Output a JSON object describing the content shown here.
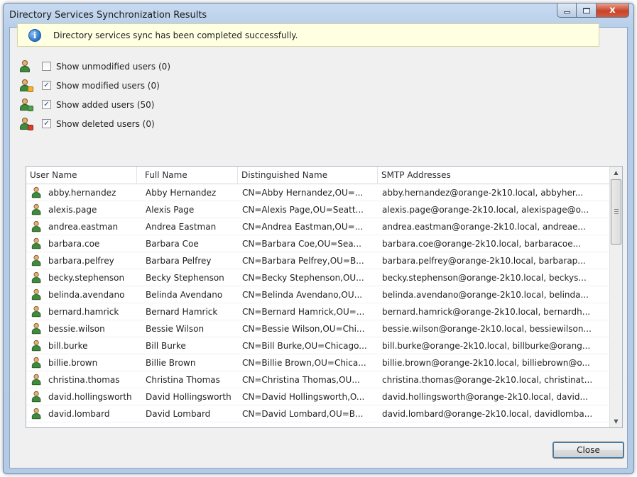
{
  "window": {
    "title": "Directory Services Synchronization Results",
    "close_glyph": "x"
  },
  "banner": {
    "icon": "info-icon",
    "icon_glyph": "i",
    "message": "Directory services sync has been completed successfully."
  },
  "filters": [
    {
      "label": "Show unmodified users (0)",
      "checked": false,
      "icon": "user-icon",
      "mark": ""
    },
    {
      "label": "Show modified users (0)",
      "checked": true,
      "icon": "user-edit-icon",
      "mark": "✓"
    },
    {
      "label": "Show added users (50)",
      "checked": true,
      "icon": "user-add-icon",
      "mark": "✓"
    },
    {
      "label": "Show deleted users (0)",
      "checked": true,
      "icon": "user-delete-icon",
      "mark": "✓"
    }
  ],
  "grid": {
    "columns": [
      "User Name",
      "Full Name",
      "Distinguished Name",
      "SMTP Addresses"
    ],
    "rows": [
      [
        "abby.hernandez",
        "Abby Hernandez",
        "CN=Abby Hernandez,OU=...",
        "abby.hernandez@orange-2k10.local, abbyher..."
      ],
      [
        "alexis.page",
        "Alexis Page",
        "CN=Alexis Page,OU=Seatt...",
        "alexis.page@orange-2k10.local, alexispage@o..."
      ],
      [
        "andrea.eastman",
        "Andrea Eastman",
        "CN=Andrea Eastman,OU=...",
        "andrea.eastman@orange-2k10.local, andreae..."
      ],
      [
        "barbara.coe",
        "Barbara Coe",
        "CN=Barbara Coe,OU=Sea...",
        "barbara.coe@orange-2k10.local, barbaracoe..."
      ],
      [
        "barbara.pelfrey",
        "Barbara Pelfrey",
        "CN=Barbara Pelfrey,OU=B...",
        "barbara.pelfrey@orange-2k10.local, barbarap..."
      ],
      [
        "becky.stephenson",
        "Becky Stephenson",
        "CN=Becky Stephenson,OU...",
        "becky.stephenson@orange-2k10.local, beckys..."
      ],
      [
        "belinda.avendano",
        "Belinda Avendano",
        "CN=Belinda Avendano,OU...",
        "belinda.avendano@orange-2k10.local, belinda..."
      ],
      [
        "bernard.hamrick",
        "Bernard Hamrick",
        "CN=Bernard Hamrick,OU=...",
        "bernard.hamrick@orange-2k10.local, bernardh..."
      ],
      [
        "bessie.wilson",
        "Bessie Wilson",
        "CN=Bessie Wilson,OU=Chi...",
        "bessie.wilson@orange-2k10.local, bessiewilson..."
      ],
      [
        "bill.burke",
        "Bill Burke",
        "CN=Bill Burke,OU=Chicago...",
        "bill.burke@orange-2k10.local, billburke@orang..."
      ],
      [
        "billie.brown",
        "Billie Brown",
        "CN=Billie Brown,OU=Chica...",
        "billie.brown@orange-2k10.local, billiebrown@o..."
      ],
      [
        "christina.thomas",
        "Christina Thomas",
        "CN=Christina Thomas,OU...",
        "christina.thomas@orange-2k10.local, christinat..."
      ],
      [
        "david.hollingsworth",
        "David Hollingsworth",
        "CN=David Hollingsworth,O...",
        "david.hollingsworth@orange-2k10.local, david..."
      ],
      [
        "david.lombard",
        "David Lombard",
        "CN=David Lombard,OU=B...",
        "david.lombard@orange-2k10.local, davidlomba..."
      ]
    ]
  },
  "scrollbar": {
    "up_glyph": "▲",
    "down_glyph": "▼"
  },
  "footer": {
    "close_label": "Close"
  },
  "colors": {
    "banner_bg": "#ffffe1",
    "window_frame": "#b4cbe6",
    "close_caption": "#c7442a",
    "user_icon_green": "#3f8a3c"
  }
}
